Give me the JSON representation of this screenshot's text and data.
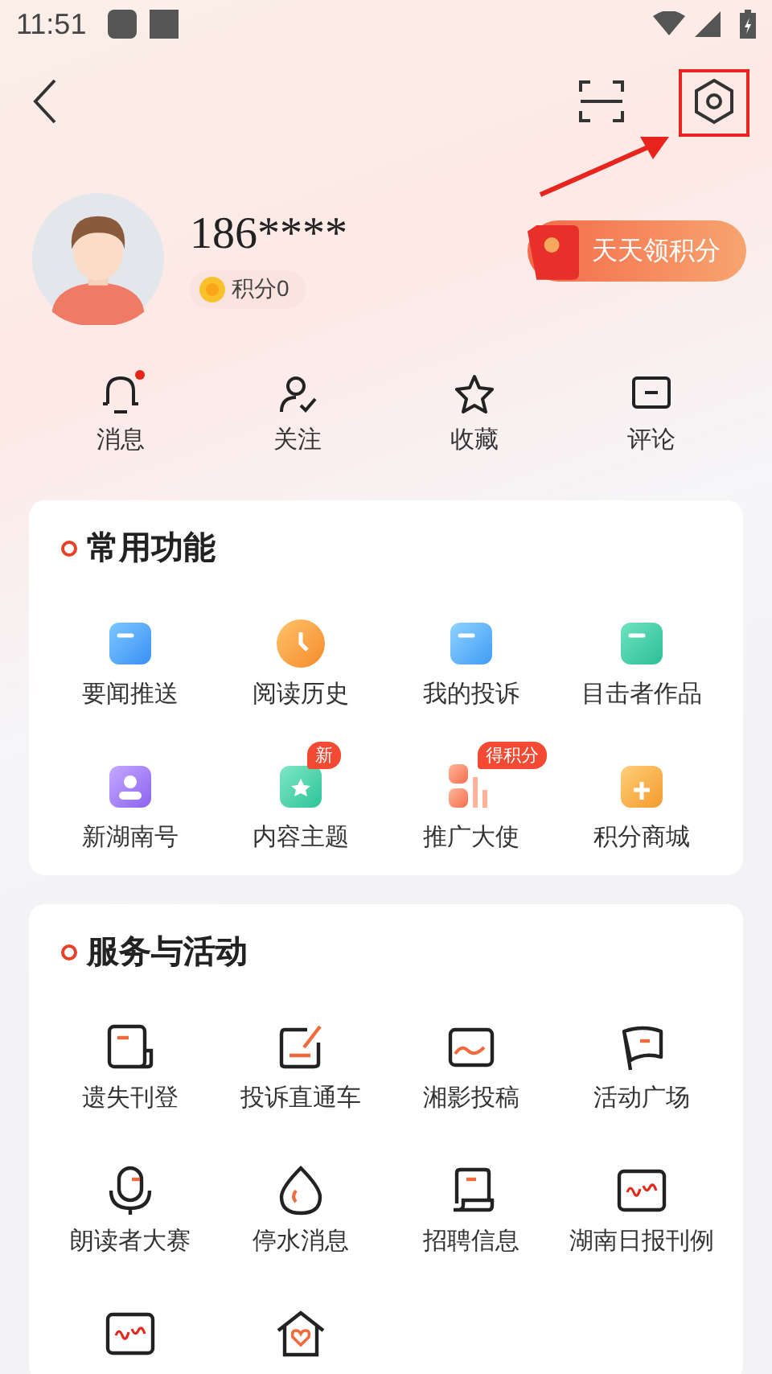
{
  "status_bar": {
    "time": "11:51"
  },
  "profile": {
    "name": "186****",
    "points": "积分0",
    "reward_button": "天天领积分"
  },
  "shortcuts": [
    {
      "label": "消息",
      "kind": "bell",
      "unread": true
    },
    {
      "label": "关注",
      "kind": "follow",
      "unread": false
    },
    {
      "label": "收藏",
      "kind": "star",
      "unread": false
    },
    {
      "label": "评论",
      "kind": "comment",
      "unread": false
    }
  ],
  "sections": [
    {
      "title": "常用功能",
      "items": [
        {
          "label": "要闻推送",
          "kind": "news"
        },
        {
          "label": "阅读历史",
          "kind": "history"
        },
        {
          "label": "我的投诉",
          "kind": "complaint"
        },
        {
          "label": "目击者作品",
          "kind": "video"
        },
        {
          "label": "新湖南号",
          "kind": "account"
        },
        {
          "label": "内容主题",
          "kind": "topic",
          "tag": "新"
        },
        {
          "label": "推广大使",
          "kind": "promote",
          "tag": "得积分"
        },
        {
          "label": "积分商城",
          "kind": "mall"
        }
      ]
    },
    {
      "title": "服务与活动",
      "items": [
        {
          "label": "遗失刊登",
          "kind": "lost"
        },
        {
          "label": "投诉直通车",
          "kind": "edit"
        },
        {
          "label": "湘影投稿",
          "kind": "photo"
        },
        {
          "label": "活动广场",
          "kind": "flag"
        },
        {
          "label": "朗读者大赛",
          "kind": "mic"
        },
        {
          "label": "停水消息",
          "kind": "water"
        },
        {
          "label": "招聘信息",
          "kind": "jobs"
        },
        {
          "label": "湖南日报刊例",
          "kind": "paper"
        },
        {
          "kind": "paper"
        },
        {
          "kind": "home"
        }
      ]
    }
  ]
}
